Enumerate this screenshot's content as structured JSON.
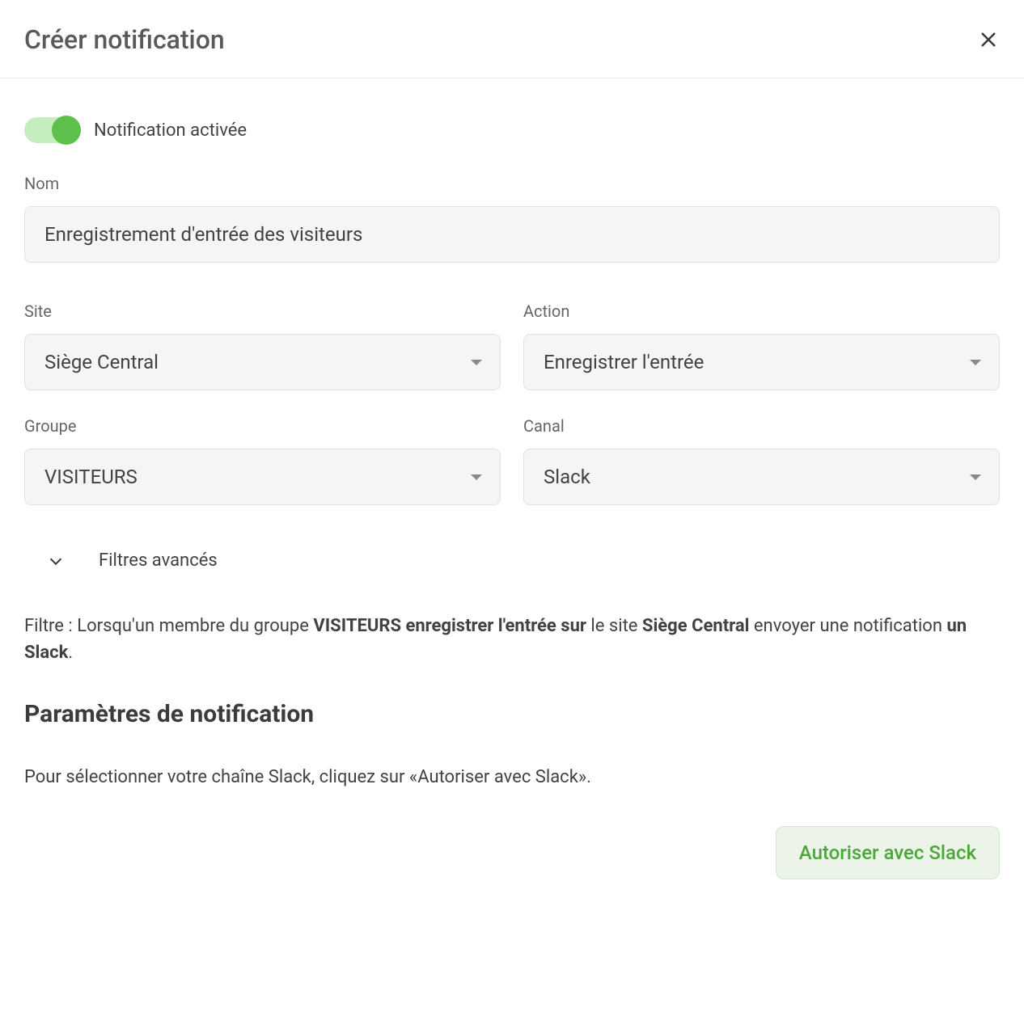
{
  "header": {
    "title": "Créer notification"
  },
  "toggle": {
    "label": "Notification activée",
    "enabled": true
  },
  "name": {
    "label": "Nom",
    "value": "Enregistrement d'entrée des visiteurs"
  },
  "site": {
    "label": "Site",
    "value": "Siège Central"
  },
  "action": {
    "label": "Action",
    "value": "Enregistrer l'entrée"
  },
  "group": {
    "label": "Groupe",
    "value": "VISITEURS"
  },
  "channel": {
    "label": "Canal",
    "value": "Slack"
  },
  "advanced": {
    "label": "Filtres avancés"
  },
  "filter_summary": {
    "prefix": "Filtre : Lorsqu'un membre du groupe ",
    "bold1": "VISITEURS enregistrer l'entrée sur",
    "mid1": " le site ",
    "bold2": "Siège Central",
    "mid2": " envoyer une notification ",
    "bold3": "un Slack",
    "suffix": "."
  },
  "settings_title": "Paramètres de notification",
  "helper_text": "Pour sélectionner votre chaîne Slack, cliquez sur «Autoriser avec Slack».",
  "authorize_button": "Autoriser avec Slack"
}
